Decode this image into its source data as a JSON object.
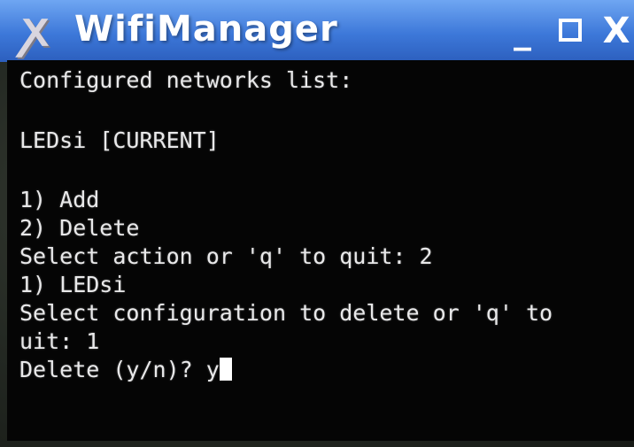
{
  "window": {
    "title": "WifiManager",
    "app_icon_glyph": "ꭗ",
    "controls": {
      "minimize_glyph": "_",
      "close_glyph": "X"
    }
  },
  "terminal": {
    "lines": [
      "Configured networks list:",
      "",
      "LEDsi [CURRENT]",
      "",
      "1) Add",
      "2) Delete",
      "Select action or 'q' to quit: 2",
      "1) LEDsi",
      "Select configuration to delete or 'q' to",
      "uit: 1"
    ],
    "prompt": "Delete (y/n)? y"
  },
  "colors": {
    "titlebar": "#3d78d9",
    "terminal_bg": "#050505",
    "terminal_text": "#e9e9ea"
  }
}
